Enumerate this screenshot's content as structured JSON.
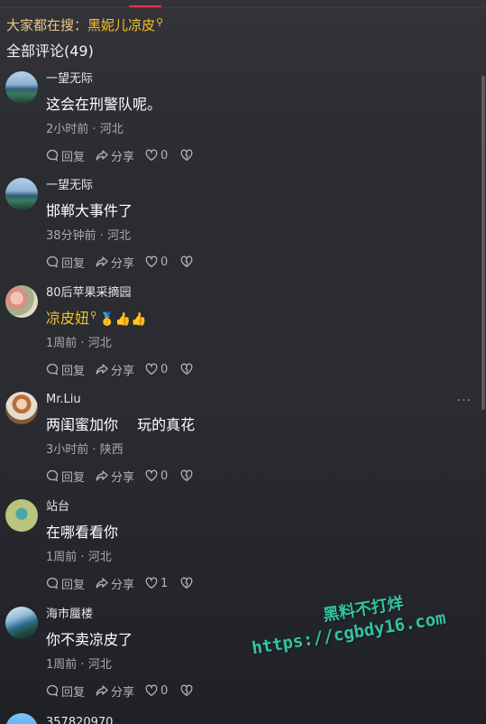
{
  "search_hint": {
    "prefix": "大家都在搜：",
    "term": "黑妮儿凉皮"
  },
  "comments_header": {
    "title": "全部评论(49)"
  },
  "comments": [
    {
      "username": "一望无际",
      "text": "这会在刑警队呢。",
      "time": "2小时前",
      "location": "河北",
      "reply_label": "回复",
      "share_label": "分享",
      "likes": "0"
    },
    {
      "username": "一望无际",
      "text": "邯郸大事件了",
      "time": "38分钟前",
      "location": "河北",
      "reply_label": "回复",
      "share_label": "分享",
      "likes": "0"
    },
    {
      "username": "80后苹果采摘园",
      "text": "凉皮妞",
      "emojis": "🥇👍👍",
      "time": "1周前",
      "location": "河北",
      "reply_label": "回复",
      "share_label": "分享",
      "likes": "0"
    },
    {
      "username": "Mr.Liu",
      "text": "两闺蜜加你　 玩的真花",
      "time": "3小时前",
      "location": "陕西",
      "reply_label": "回复",
      "share_label": "分享",
      "likes": "0"
    },
    {
      "username": "站台",
      "text": "在哪看看你",
      "time": "1周前",
      "location": "河北",
      "reply_label": "回复",
      "share_label": "分享",
      "likes": "1"
    },
    {
      "username": "海市蜃楼",
      "text": "你不卖凉皮了",
      "time": "1周前",
      "location": "河北",
      "reply_label": "回复",
      "share_label": "分享",
      "likes": "0"
    },
    {
      "username": "357820970"
    }
  ],
  "meta_separator": "·",
  "more_icon": "···",
  "watermark": {
    "title": "黑料不打烊",
    "url": "https://cgbdy16.com"
  },
  "colors": {
    "accent": "#fe2c55",
    "link": "#f5c226",
    "watermark": "#33c4a2"
  },
  "icons": {
    "reply": "speech-bubble-icon",
    "share": "share-arrow-icon",
    "like": "heart-icon",
    "dislike": "broken-heart-icon",
    "search": "magnifier-icon"
  }
}
